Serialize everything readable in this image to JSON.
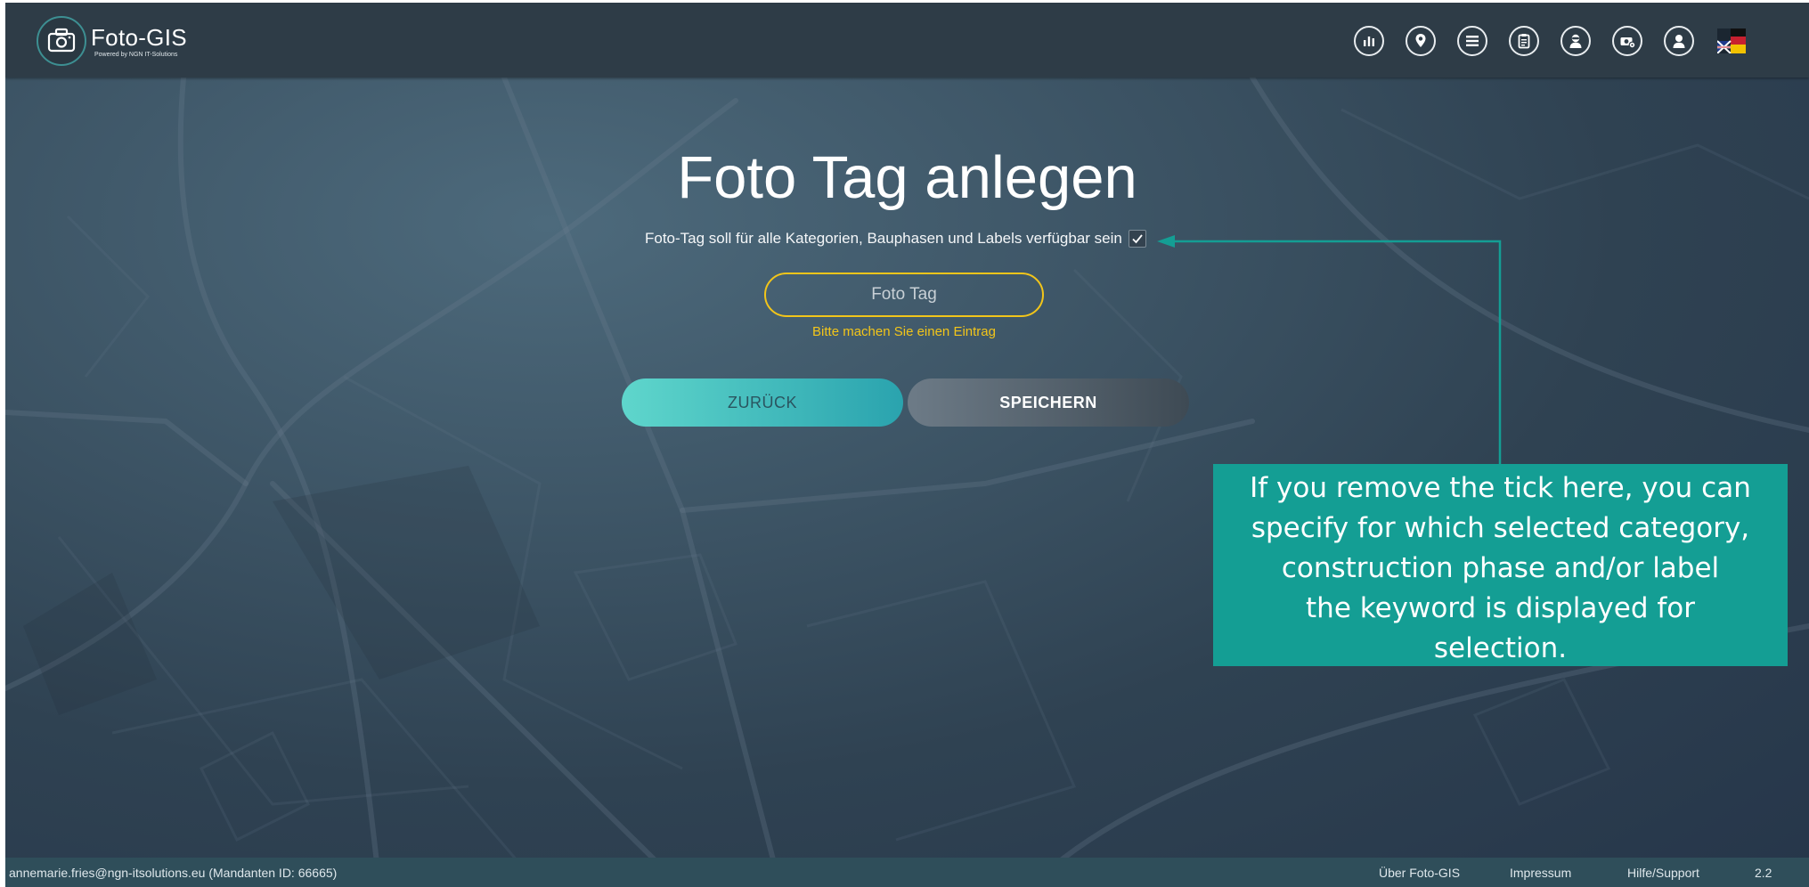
{
  "header": {
    "brand": "Foto-GIS",
    "brand_sub": "Powered by NGN IT-Solutions",
    "nav_icons": [
      "statistics-icon",
      "map-pin-icon",
      "list-icon",
      "clipboard-icon",
      "user-admin-icon",
      "camera-settings-icon",
      "profile-icon",
      "language-flag-icon"
    ]
  },
  "main": {
    "title": "Foto Tag anlegen",
    "checkbox_label": "Foto-Tag soll für alle Kategorien, Bauphasen und Labels verfügbar sein",
    "checkbox_checked": true,
    "input_placeholder": "Foto Tag",
    "input_value": "",
    "error_text": "Bitte machen Sie einen Eintrag",
    "back_label": "ZURÜCK",
    "save_label": "SPEICHERN"
  },
  "annotation": {
    "lines": [
      "If you remove the tick here, you can",
      "specify for which selected category,",
      "construction phase and/or label",
      "the keyword is displayed for",
      "selection."
    ]
  },
  "footer": {
    "user": "annemarie.fries@ngn-itsolutions.eu (Mandanten ID: 66665)",
    "about": "Über Foto-GIS",
    "imprint": "Impressum",
    "help": "Hilfe/Support",
    "version": "2.2"
  },
  "colors": {
    "accent_teal": "#149e94",
    "warning_yellow": "#f2c51a",
    "header_bg": "#2e3c47"
  }
}
